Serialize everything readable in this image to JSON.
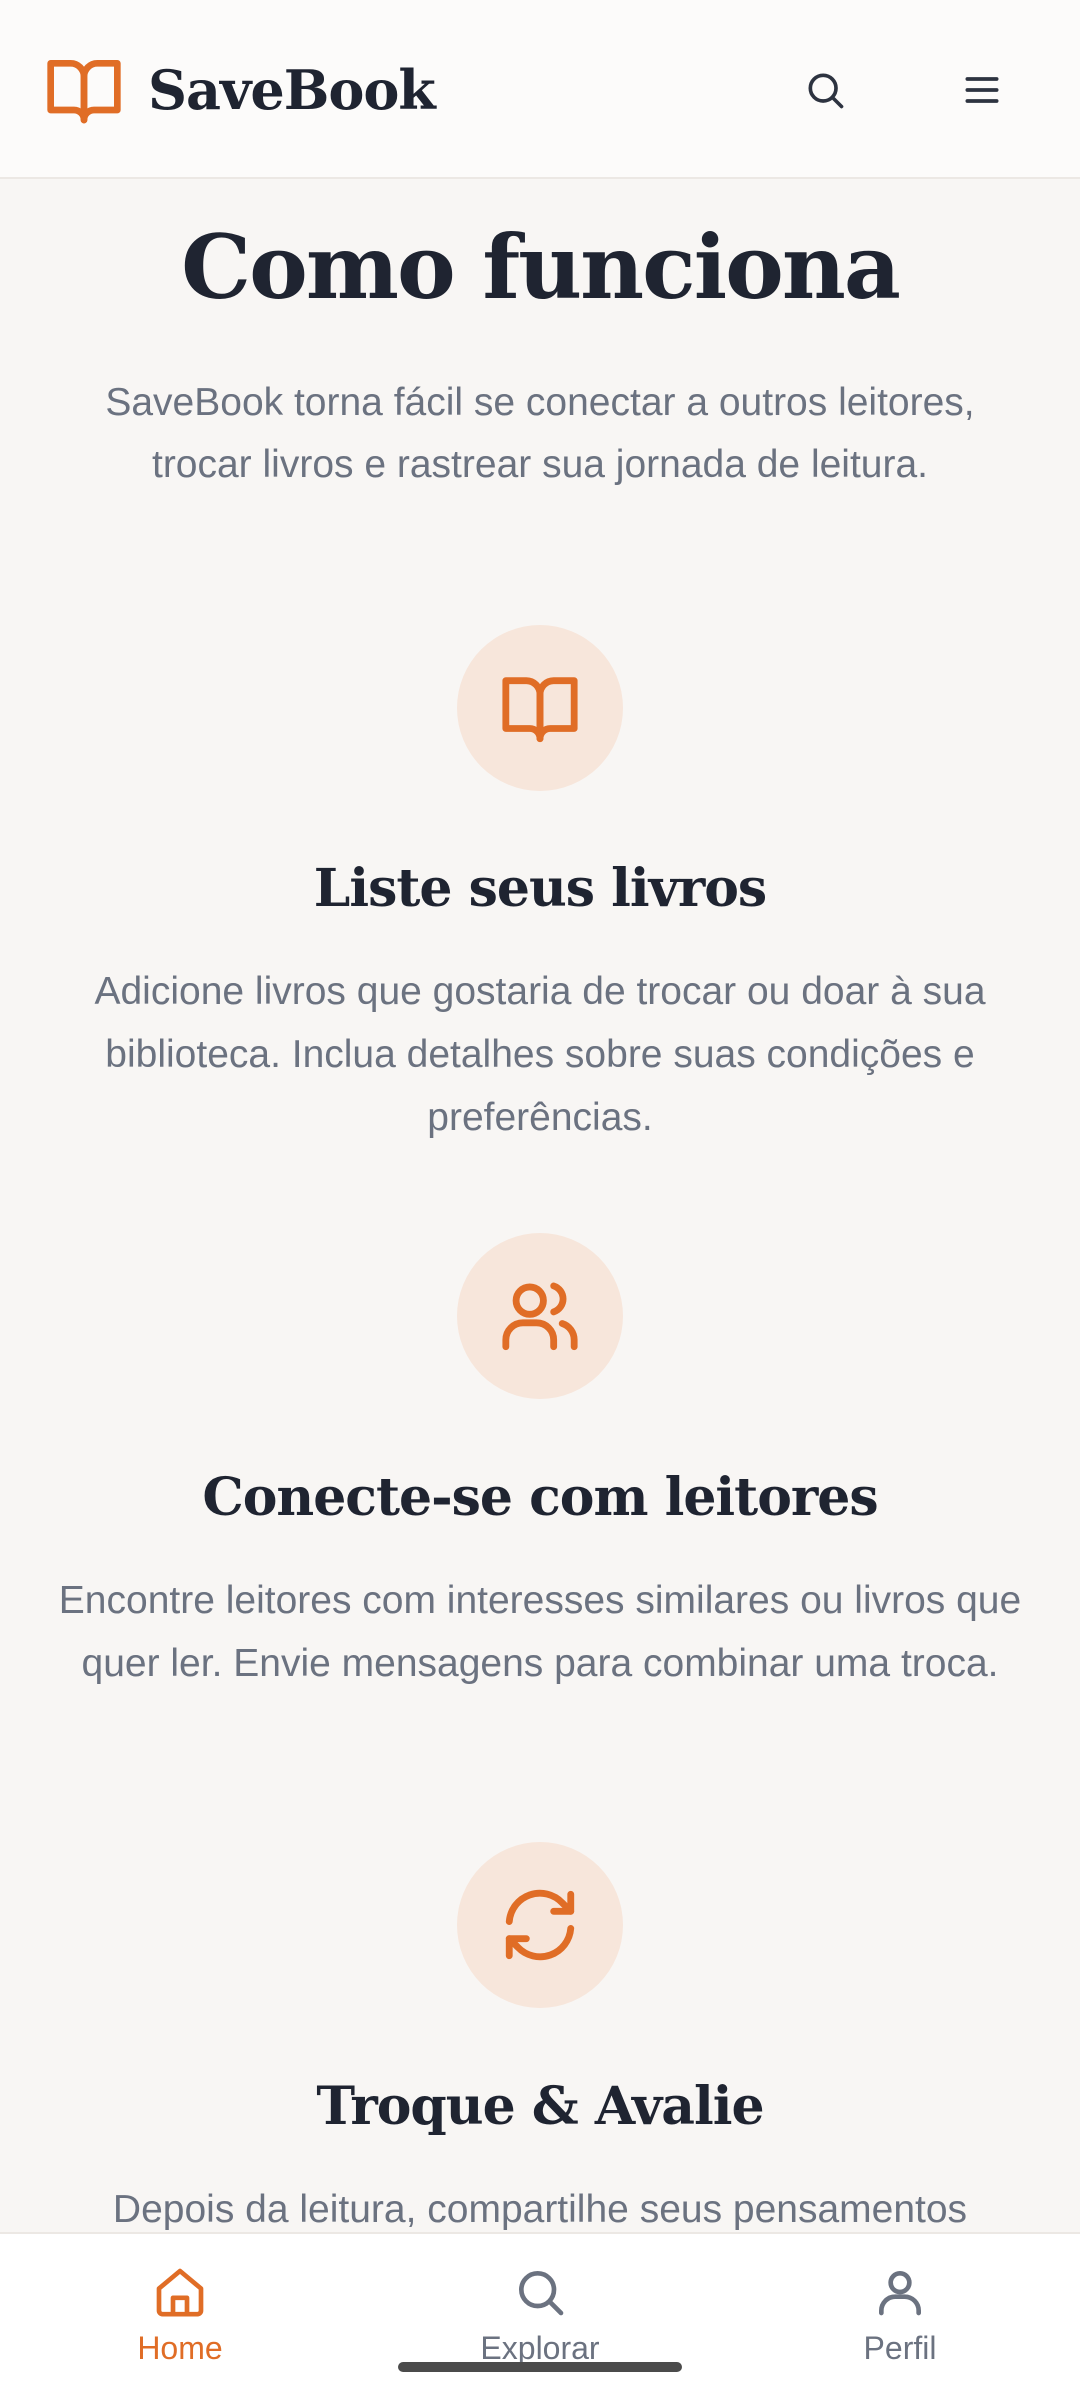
{
  "header": {
    "brand_name": "SaveBook",
    "brand_icon": "book-open-icon",
    "search_icon": "search-icon",
    "menu_icon": "hamburger-menu-icon"
  },
  "how_it_works": {
    "title": "Como funciona",
    "intro": "SaveBook torna fácil se conectar a outros leitores, trocar livros e rastrear sua jornada de leitura.",
    "steps": [
      {
        "icon": "book-open-icon",
        "title": "Liste seus livros",
        "description": "Adicione livros que gostaria de trocar ou doar à sua biblioteca. Inclua detalhes sobre suas condições e preferências."
      },
      {
        "icon": "users-icon",
        "title": "Conecte-se com leitores",
        "description": "Encontre leitores com interesses similares ou livros que quer ler. Envie mensagens para combinar uma troca."
      },
      {
        "icon": "refresh-icon",
        "title": "Troque & Avalie",
        "description": "Depois da leitura, compartilhe seus pensamentos"
      }
    ]
  },
  "bottom_nav": {
    "items": [
      {
        "label": "Home",
        "icon": "home-icon",
        "active": true
      },
      {
        "label": "Explorar",
        "icon": "search-icon",
        "active": false
      },
      {
        "label": "Perfil",
        "icon": "user-icon",
        "active": false
      }
    ]
  },
  "colors": {
    "accent": "#e06d26",
    "icon_bg": "#f7e6db",
    "heading": "#1f2431",
    "body_text": "#6b7280",
    "page_bg": "#f8f6f4"
  }
}
